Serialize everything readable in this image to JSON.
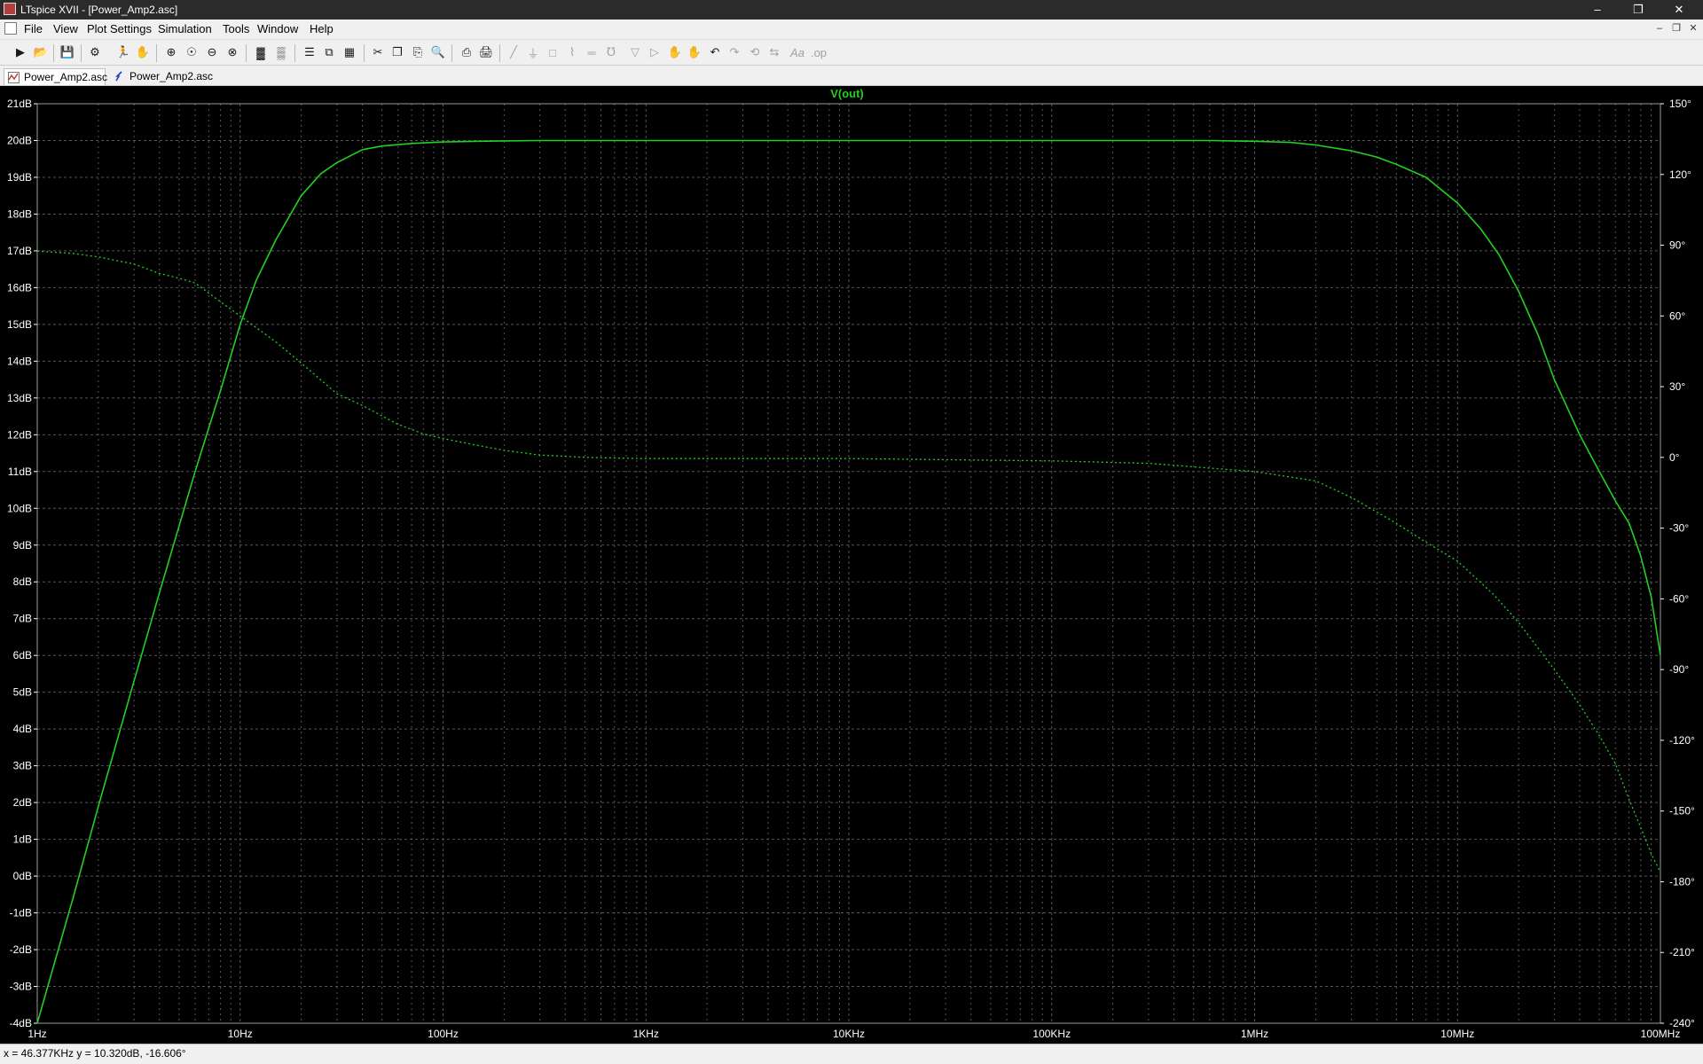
{
  "window": {
    "title": "LTspice XVII - [Power_Amp2.asc]"
  },
  "menu": [
    "File",
    "View",
    "Plot Settings",
    "Simulation",
    "Tools",
    "Window",
    "Help"
  ],
  "tabs": [
    {
      "label": "Power_Amp2.asc",
      "kind": "waveform",
      "active": true
    },
    {
      "label": "Power_Amp2.asc",
      "kind": "schematic",
      "active": false
    }
  ],
  "status": {
    "text": "x = 46.377KHz    y = 10.320dB, -16.606°"
  },
  "colors": {
    "trace": "#22d022",
    "grid": "#555555",
    "axis_text": "#ffffff",
    "background": "#000000"
  },
  "chart_data": {
    "type": "line",
    "title": "V(out)",
    "x_scale": "log",
    "xlim": [
      1,
      100000000
    ],
    "x_ticks": [
      "1Hz",
      "10Hz",
      "100Hz",
      "1KHz",
      "10KHz",
      "100KHz",
      "1MHz",
      "10MHz",
      "100MHz"
    ],
    "ylim_left": [
      -4,
      21
    ],
    "y_ticks_left": [
      "21dB",
      "20dB",
      "19dB",
      "18dB",
      "17dB",
      "16dB",
      "15dB",
      "14dB",
      "13dB",
      "12dB",
      "11dB",
      "10dB",
      "9dB",
      "8dB",
      "7dB",
      "6dB",
      "5dB",
      "4dB",
      "3dB",
      "2dB",
      "1dB",
      "0dB",
      "-1dB",
      "-2dB",
      "-3dB",
      "-4dB"
    ],
    "ylim_right": [
      -240,
      150
    ],
    "y_ticks_right": [
      "150°",
      "120°",
      "90°",
      "60°",
      "30°",
      "0°",
      "-30°",
      "-60°",
      "-90°",
      "-120°",
      "-150°",
      "-180°",
      "-210°",
      "-240°"
    ],
    "grid": true,
    "series": [
      {
        "quantity": "magnitude",
        "axis": "left",
        "style": "solid",
        "x": [
          1,
          1.5,
          2,
          3,
          4,
          6,
          8,
          10,
          12,
          15,
          20,
          25,
          30,
          40,
          50,
          70,
          100,
          150,
          200,
          300,
          500,
          1000,
          10000,
          100000,
          300000,
          600000,
          1000000,
          1500000,
          2000000,
          3000000,
          4000000,
          5000000,
          7000000,
          10000000,
          13000000,
          16000000,
          20000000,
          25000000,
          30000000,
          40000000,
          50000000,
          60000000,
          70000000,
          80000000,
          90000000,
          100000000
        ],
        "values": [
          -4.0,
          -0.6,
          1.9,
          5.3,
          7.7,
          11.0,
          13.2,
          15.0,
          16.2,
          17.3,
          18.5,
          19.1,
          19.4,
          19.75,
          19.85,
          19.92,
          19.96,
          19.98,
          19.99,
          20.0,
          20.0,
          20.0,
          20.0,
          20.0,
          20.0,
          20.0,
          19.98,
          19.95,
          19.88,
          19.72,
          19.55,
          19.35,
          19.0,
          18.3,
          17.6,
          16.9,
          15.9,
          14.7,
          13.5,
          12.0,
          11.0,
          10.2,
          9.6,
          8.7,
          7.6,
          6.0
        ]
      },
      {
        "quantity": "phase",
        "axis": "right",
        "style": "dotted",
        "x": [
          1,
          1.5,
          2,
          3,
          4,
          5,
          6,
          8,
          10,
          15,
          20,
          30,
          40,
          60,
          80,
          100,
          150,
          200,
          300,
          500,
          1000,
          10000,
          100000,
          300000,
          500000,
          1000000,
          2000000,
          3000000,
          5000000,
          7000000,
          10000000,
          15000000,
          20000000,
          30000000,
          40000000,
          50000000,
          60000000,
          70000000,
          80000000,
          90000000,
          100000000
        ],
        "values": [
          87.5,
          86.5,
          85,
          82,
          78,
          76,
          74,
          66,
          60,
          49,
          40,
          27,
          22,
          14,
          10,
          8,
          5,
          3,
          1,
          0,
          -0.5,
          -0.5,
          -1.5,
          -2.5,
          -4,
          -6,
          -10,
          -17,
          -28,
          -36,
          -44,
          -58,
          -70,
          -90,
          -105,
          -118,
          -130,
          -145,
          -157,
          -168,
          -176
        ]
      }
    ]
  }
}
